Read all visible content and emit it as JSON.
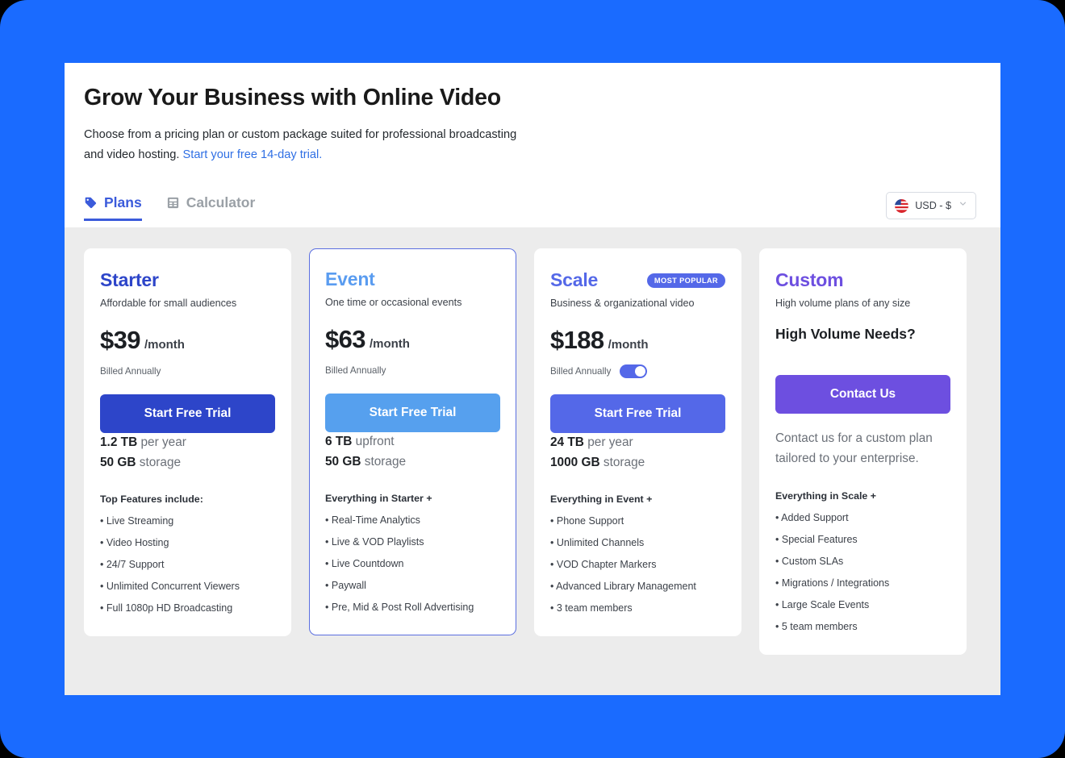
{
  "header": {
    "title": "Grow Your Business with Online Video",
    "subtitle_text": "Choose from a pricing plan or custom package suited for professional broadcasting and video hosting.",
    "trial_link": "Start your free 14-day trial."
  },
  "tabs": [
    {
      "label": "Plans",
      "icon": "tag-icon",
      "active": true
    },
    {
      "label": "Calculator",
      "icon": "calculator-icon",
      "active": false
    }
  ],
  "currency": {
    "label": "USD - $",
    "flag": "us-flag-icon",
    "chevron": "chevron-down-icon"
  },
  "colors": {
    "page_background": "#1a6bff",
    "cards_background": "#ececec",
    "starter": "#2d45c9",
    "event": "#5a9cf0",
    "scale": "#5468e8",
    "custom": "#6d4fe0",
    "link": "#2f6fe4"
  },
  "plans": [
    {
      "name": "Starter",
      "description": "Affordable for small audiences",
      "price": "$39",
      "period": "/month",
      "billed": "Billed Annually",
      "has_toggle": false,
      "badge": null,
      "cta": "Start Free Trial",
      "spec_1_value": "1.2 TB",
      "spec_1_label": "per year",
      "spec_2_value": "50 GB",
      "spec_2_label": "storage",
      "features_title": "Top Features include:",
      "features": [
        "Live Streaming",
        "Video Hosting",
        "24/7 Support",
        "Unlimited Concurrent Viewers",
        "Full 1080p HD Broadcasting"
      ]
    },
    {
      "name": "Event",
      "description": "One time or occasional events",
      "price": "$63",
      "period": "/month",
      "billed": "Billed Annually",
      "has_toggle": false,
      "badge": null,
      "cta": "Start Free Trial",
      "spec_1_value": "6 TB",
      "spec_1_label": "upfront",
      "spec_2_value": "50 GB",
      "spec_2_label": "storage",
      "features_title": "Everything in Starter +",
      "features": [
        "Real-Time Analytics",
        "Live & VOD Playlists",
        "Live Countdown",
        "Paywall",
        "Pre, Mid & Post Roll Advertising"
      ]
    },
    {
      "name": "Scale",
      "description": "Business & organizational video",
      "price": "$188",
      "period": "/month",
      "billed": "Billed Annually",
      "has_toggle": true,
      "toggle_state": "on",
      "badge": "MOST POPULAR",
      "cta": "Start Free Trial",
      "spec_1_value": "24 TB",
      "spec_1_label": "per year",
      "spec_2_value": "1000 GB",
      "spec_2_label": "storage",
      "features_title": "Everything in Event +",
      "features": [
        "Phone Support",
        "Unlimited Channels",
        "VOD Chapter Markers",
        "Advanced Library Management",
        "3 team members"
      ]
    },
    {
      "name": "Custom",
      "description": "High volume plans of any size",
      "headline": "High Volume Needs?",
      "cta": "Contact Us",
      "blurb": "Contact us for a custom plan tailored to your enterprise.",
      "features_title": "Everything in Scale +",
      "features": [
        "Added Support",
        "Special Features",
        "Custom SLAs",
        "Migrations / Integrations",
        "Large Scale Events",
        "5 team members"
      ]
    }
  ]
}
